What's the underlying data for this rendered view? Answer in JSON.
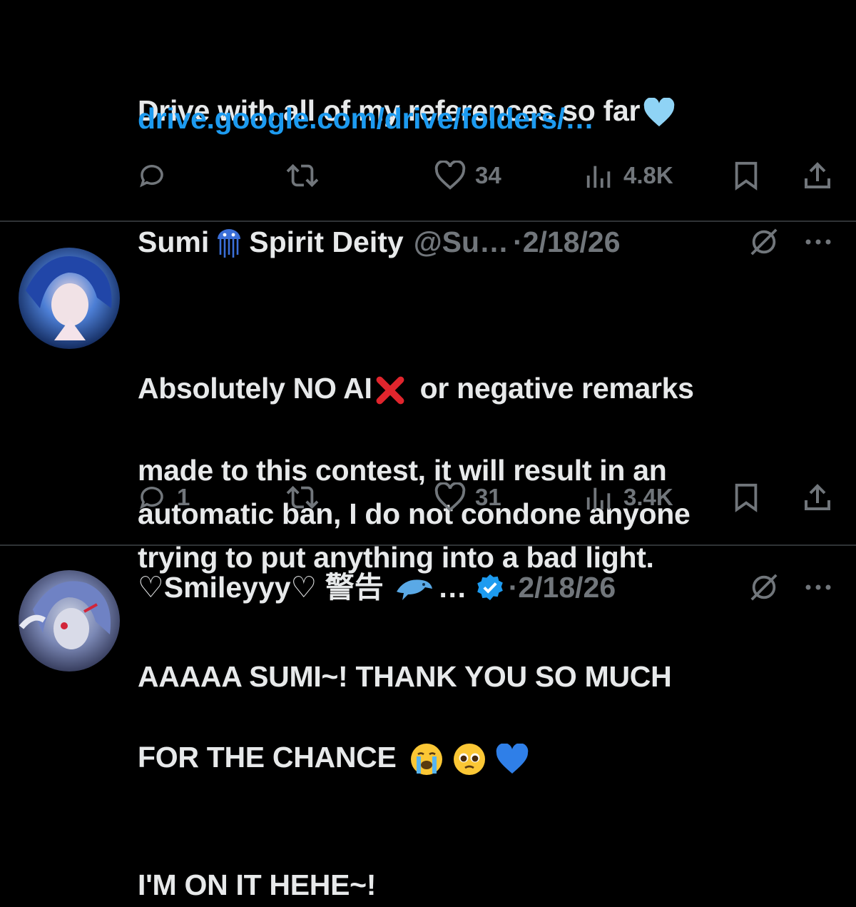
{
  "tweets": [
    {
      "text": "Drive with all of my references so far",
      "text_emoji": "light-blue-heart",
      "link": "drive.google.com/drive/folders/…",
      "actions": {
        "replies": "",
        "likes": "34",
        "views": "4.8K"
      }
    },
    {
      "display_name": "Sumi",
      "display_name_suffix": "Spirit Deity",
      "name_emoji": "jellyfish",
      "handle": "@Su…",
      "separator": "·",
      "date": "2/18/26",
      "text_1": "Absolutely NO AI",
      "text_emoji": "red-cross-mark",
      "text_2": " or negative remarks\nmade to this contest, it will result in an\nautomatic ban, I do not condone anyone\ntrying to put anything into a bad light.",
      "actions": {
        "replies": "1",
        "likes": "31",
        "views": "3.4K"
      }
    },
    {
      "display_name": "♡Smileyyy♡ 警告",
      "name_emoji": "dolphin",
      "name_ellipsis": "…",
      "verified": true,
      "separator": "·",
      "date": "2/18/26",
      "text_1": "AAAAA SUMI~! THANK YOU SO MUCH\nFOR THE CHANCE",
      "text_emojis": [
        "loudly-crying-face",
        "pleading-face",
        "blue-heart"
      ],
      "text_2": "I'M ON IT HEHE~!"
    }
  ],
  "colors": {
    "background": "#000000",
    "text": "#e7e9ea",
    "muted": "#71767b",
    "link": "#1d9bf0",
    "divider": "#2f3336",
    "verified": "#1d9bf0"
  }
}
